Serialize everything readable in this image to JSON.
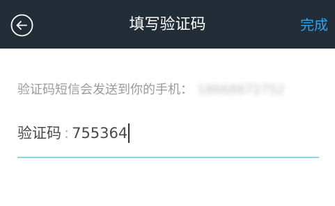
{
  "navbar": {
    "title": "填写验证码",
    "done_label": "完成",
    "back_icon": "back-arrow-circle-icon",
    "colors": {
      "background": "#232d38",
      "title": "#ffffff",
      "done": "#2aa3f2"
    }
  },
  "form": {
    "notice_text": "验证码短信会发送到你的手机：",
    "phone_number": "18668872752",
    "code_label": "验证码",
    "code_separator": ":",
    "code_value": "755364",
    "underline_color": "#8fd0f0"
  }
}
